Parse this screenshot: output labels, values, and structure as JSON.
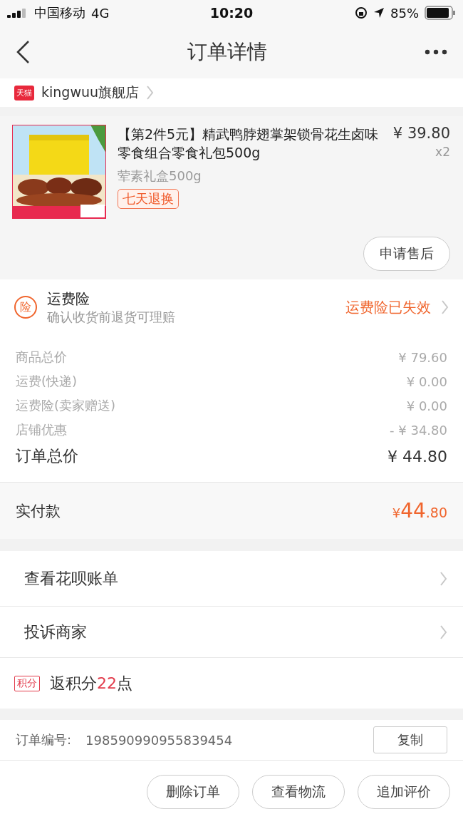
{
  "status_bar": {
    "carrier": "中国移动",
    "network": "4G",
    "time": "10:20",
    "battery": "85%"
  },
  "nav": {
    "title": "订单详情"
  },
  "shop": {
    "badge": "天猫",
    "name": "kingwuu旗舰店"
  },
  "product": {
    "title": "【第2件5元】精武鸭脖翅掌架锁骨花生卤味零食组合零食礼包500g",
    "sku": "荤素礼盒500g",
    "tag": "七天退换",
    "price": "¥ 39.80",
    "quantity": "x2",
    "after_sale_button": "申请售后"
  },
  "insurance": {
    "icon": "险",
    "title": "运费险",
    "subtitle": "确认收货前退货可理赔",
    "status": "运费险已失效"
  },
  "price_lines": [
    {
      "label": "商品总价",
      "value": "¥ 79.60"
    },
    {
      "label": "运费(快递)",
      "value": "¥ 0.00"
    },
    {
      "label": "运费险(卖家赠送)",
      "value": "¥ 0.00"
    },
    {
      "label": "店铺优惠",
      "value": "- ¥ 34.80"
    }
  ],
  "order_total": {
    "label": "订单总价",
    "value": "¥ 44.80"
  },
  "paid": {
    "label": "实付款",
    "currency": "¥ ",
    "integer": "44",
    "decimal": ".80"
  },
  "links": [
    {
      "label": "查看花呗账单"
    },
    {
      "label": "投诉商家"
    }
  ],
  "points": {
    "badge": "积分",
    "prefix": "返积分",
    "value": "22",
    "suffix": "点"
  },
  "order_number": {
    "label": "订单编号:",
    "value": "198590990955839454",
    "copy_button": "复制"
  },
  "actions": [
    "删除订单",
    "查看物流",
    "追加评价"
  ]
}
